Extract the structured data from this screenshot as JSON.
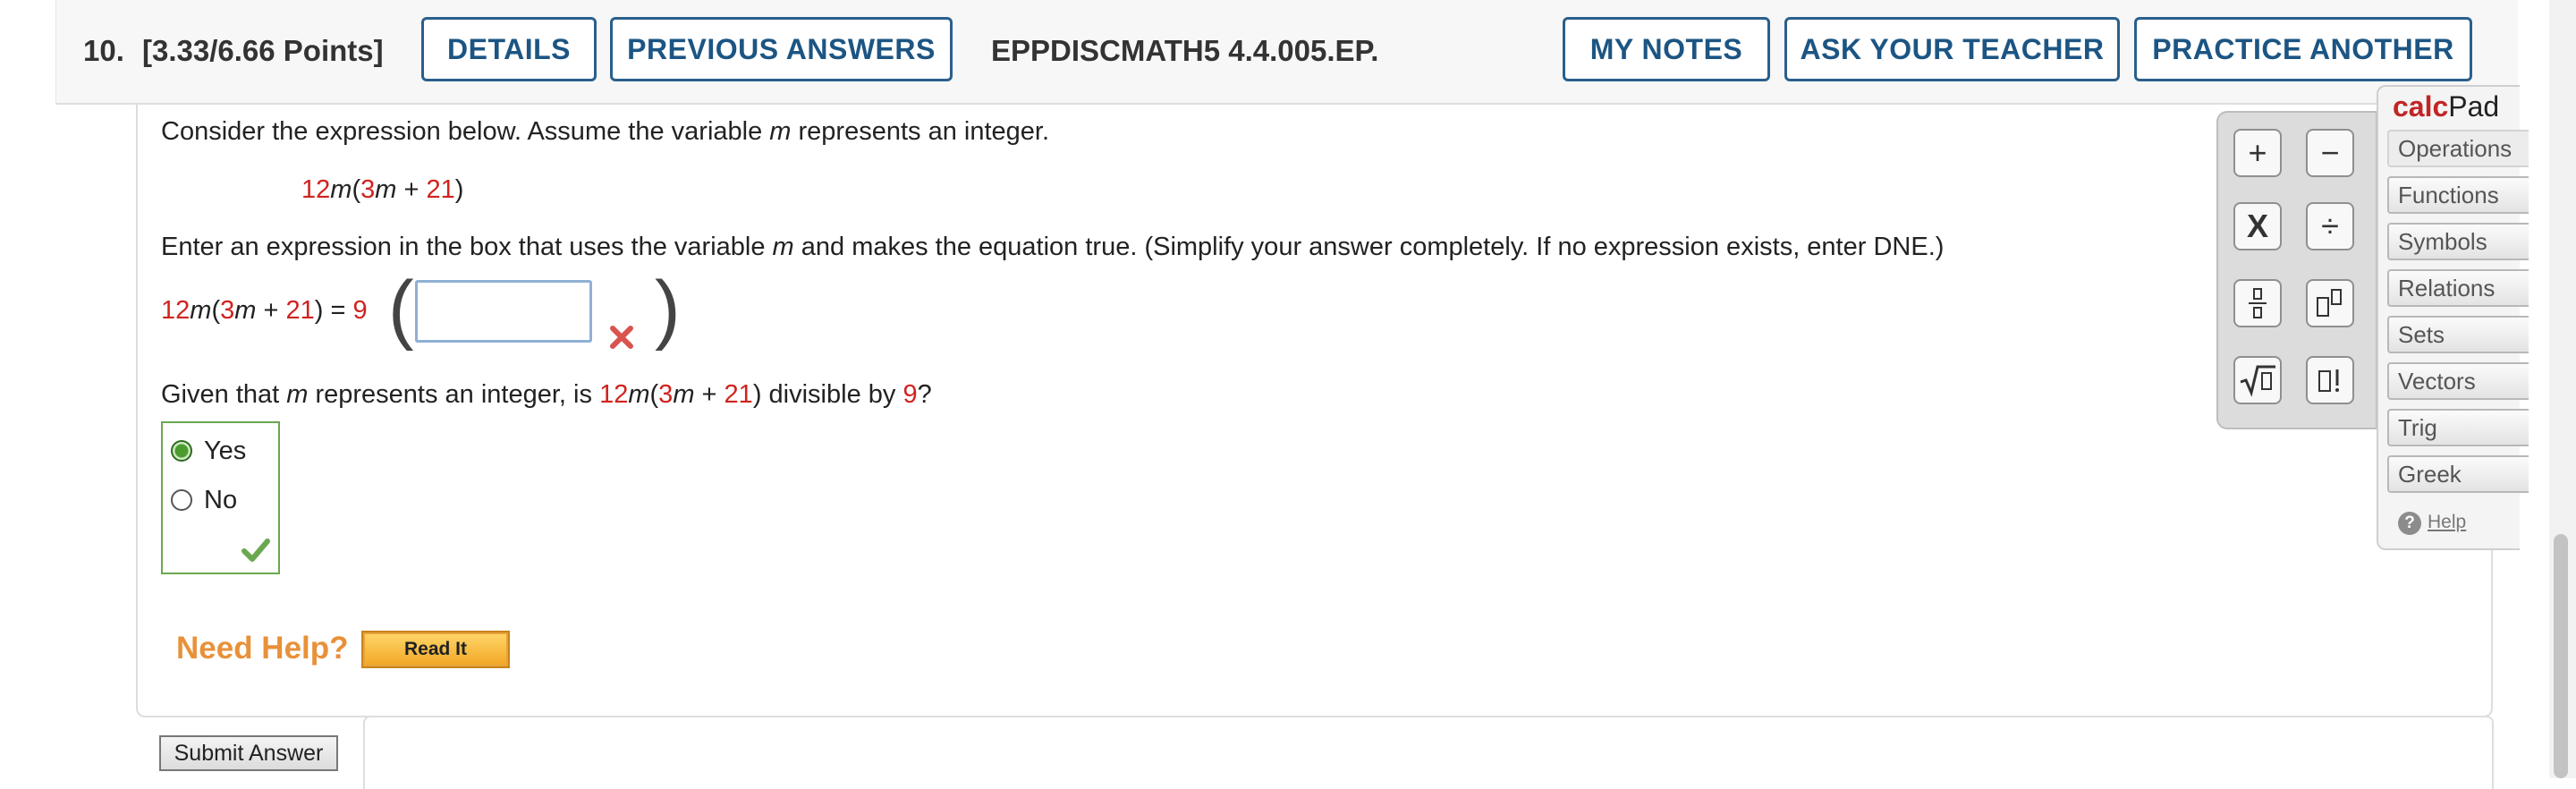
{
  "header": {
    "number": "10.",
    "points": "[3.33/6.66 Points]",
    "details": "DETAILS",
    "previous_answers": "PREVIOUS ANSWERS",
    "code": "EPPDISCMATH5 4.4.005.EP.",
    "my_notes": "MY NOTES",
    "ask_teacher": "ASK YOUR TEACHER",
    "practice_another": "PRACTICE ANOTHER"
  },
  "question": {
    "intro_a": "Consider the expression below. Assume the variable ",
    "intro_var": "m",
    "intro_b": " represents an integer.",
    "expr": {
      "n12": "12",
      "m": "m",
      "open": "(",
      "n3": "3",
      "m2": "m",
      "plus": " + ",
      "n21": "21",
      "close": ")"
    },
    "instr_a": "Enter an expression in the box that uses the variable ",
    "instr_var": "m",
    "instr_b": " and makes the equation true. (Simplify your answer completely. If no expression exists, enter DNE.)",
    "eq_equals": ") = ",
    "eq_nine": "9",
    "answer_value": "",
    "answer_status": "incorrect",
    "q2_a": "Given that ",
    "q2_var": "m",
    "q2_b": " represents an integer, is ",
    "q2_c": " divisible by ",
    "q2_nine": "9",
    "q2_end": "?",
    "options": [
      {
        "label": "Yes",
        "selected": true
      },
      {
        "label": "No",
        "selected": false
      }
    ],
    "mc_status": "correct"
  },
  "help": {
    "need_help": "Need Help?",
    "read_it": "Read It"
  },
  "submit": "Submit Answer",
  "calcpad": {
    "title_bold": "calc",
    "title_rest": "Pad",
    "buttons": [
      "+",
      "−",
      "X",
      "÷",
      "fraction",
      "superscript",
      "square-root",
      "factorial"
    ],
    "tabs": [
      "Operations",
      "Functions",
      "Symbols",
      "Relations",
      "Sets",
      "Vectors",
      "Trig",
      "Greek"
    ],
    "help": "Help"
  },
  "colors": {
    "accent": "#1c5583",
    "red": "#d0231f",
    "correct": "#6aa84f",
    "help": "#e8913a"
  }
}
